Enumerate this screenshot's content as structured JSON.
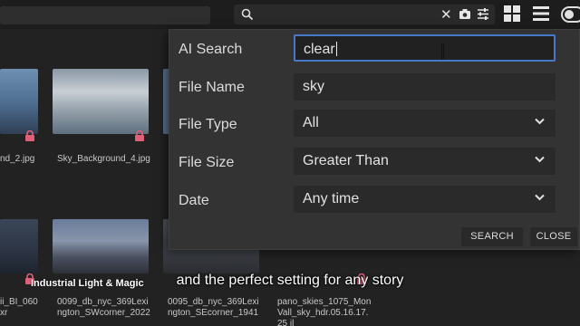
{
  "search": {
    "query": ""
  },
  "gallery": {
    "captions_row1": [
      "nd_2.jpg",
      "Sky_Background_4.jpg"
    ],
    "captions_row2": [
      [
        "ii_BI_060",
        "xr"
      ],
      [
        "0099_db_nyc_369Lexi",
        "ngton_SWcorner_2022"
      ],
      [
        "0095_db_nyc_369Lexi",
        "ngton_SEcorner_1941"
      ],
      [
        "pano_skies_1075_Mon",
        "Vall_sky_hdr.05.16.17.",
        "25 jl"
      ]
    ],
    "overlay_label": "Industrial Light & Magic"
  },
  "dialog": {
    "ai_search": {
      "label": "AI Search",
      "value": "clear"
    },
    "file_name": {
      "label": "File Name",
      "value": "sky"
    },
    "file_type": {
      "label": "File Type",
      "value": "All"
    },
    "file_size": {
      "label": "File Size",
      "value": "Greater Than"
    },
    "date": {
      "label": "Date",
      "value": "Any time"
    },
    "search_button": "SEARCH",
    "close_button": "CLOSE"
  },
  "subtitle": "and the perfect setting for any story",
  "colors": {
    "accent": "#4a78c8",
    "lock": "#e0607a",
    "panel": "#333333"
  }
}
